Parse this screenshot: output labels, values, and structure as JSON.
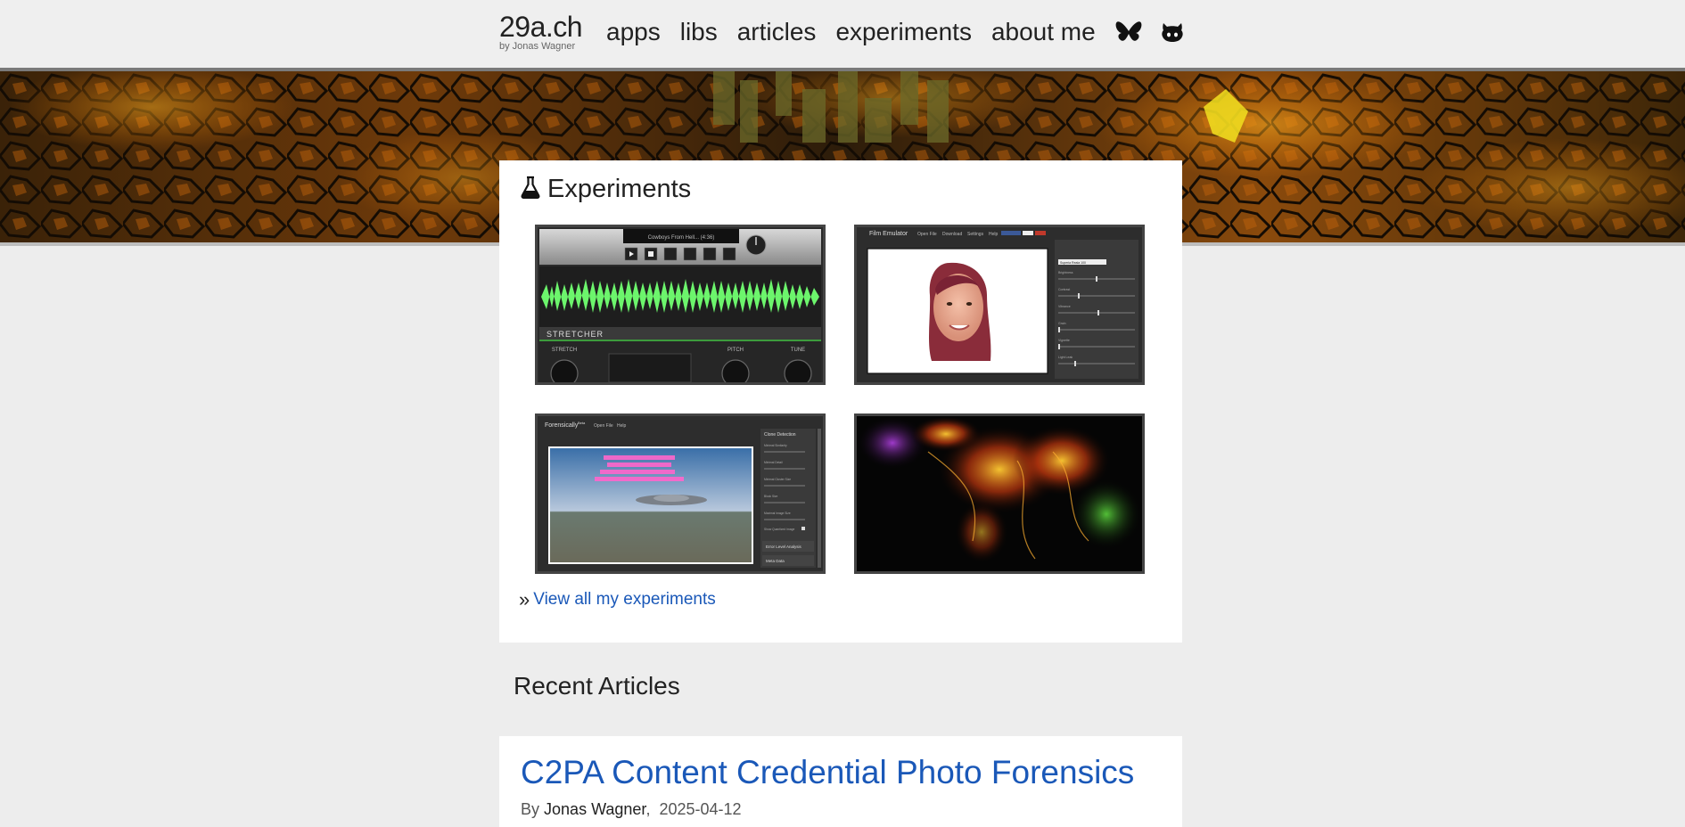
{
  "header": {
    "brand_name": "29a.ch",
    "brand_sub": "by Jonas Wagner",
    "nav": [
      "apps",
      "libs",
      "articles",
      "experiments",
      "about me"
    ],
    "icons": [
      "bluesky-icon",
      "github-icon"
    ]
  },
  "experiments": {
    "title": "Experiments",
    "title_icon": "flask-icon",
    "thumbs": {
      "stretcher": {
        "track": "Cowboys From Hell...  (4:36)",
        "panel_label": "STRETCHER",
        "knobs": [
          "STRETCH",
          "PITCH",
          "TUNE"
        ]
      },
      "film": {
        "app_title": "Film Emulator",
        "menu": [
          "Open File",
          "Download",
          "Settings",
          "Help"
        ],
        "preset": "Superia Reala 100",
        "sliders": [
          "Brightness",
          "Contrast",
          "Vibrance",
          "Grain",
          "Vignette",
          "Light Leak"
        ]
      },
      "forensics": {
        "app_title": "Forensically",
        "app_title_sup": "Beta",
        "menu": [
          "Open File",
          "Help"
        ],
        "panel_title": "Clone Detection",
        "sliders": [
          "Minimal Similarity",
          "Minimal Detail",
          "Minimal Cluster Size",
          "Block Size",
          "Maximal Image Size"
        ],
        "checkbox_label": "Show Quantized Image",
        "sections": [
          "Error Level Analysis",
          "Meta Data"
        ]
      }
    },
    "view_all_marker": "»",
    "view_all_label": "View all my experiments"
  },
  "recent": {
    "heading": "Recent Articles",
    "articles": [
      {
        "title": "C2PA Content Credential Photo Forensics",
        "by": "By",
        "author": "Jonas Wagner",
        "date": "2025-04-12"
      }
    ]
  },
  "colors": {
    "link": "#1a58b8",
    "waveform": "#6cf56c",
    "background": "#ededed"
  }
}
